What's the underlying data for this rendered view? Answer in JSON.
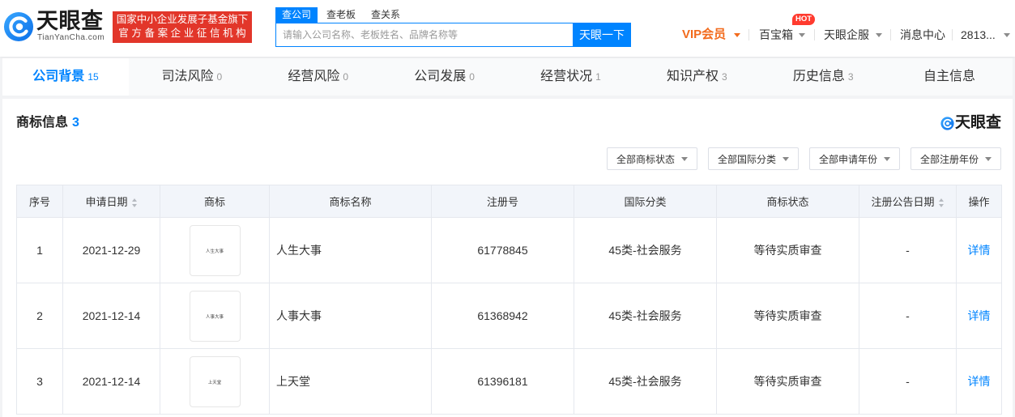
{
  "header": {
    "logo": {
      "name": "天眼查",
      "domain": "TianYanCha.com"
    },
    "badge": {
      "line1": "国家中小企业发展子基金旗下",
      "line2": "官方备案企业征信机构"
    },
    "search_tabs": [
      {
        "label": "查公司",
        "active": true
      },
      {
        "label": "查老板"
      },
      {
        "label": "查关系"
      }
    ],
    "search": {
      "placeholder": "请输入公司名称、老板姓名、品牌名称等",
      "value": "",
      "button_label": "天眼一下"
    },
    "nav": {
      "vip": "VIP会员",
      "treasure": "百宝箱",
      "hot_badge": "HOT",
      "services": "天眼企服",
      "messages": "消息中心",
      "user": "2813..."
    }
  },
  "tabs": [
    {
      "label": "公司背景",
      "count": "15",
      "active": true
    },
    {
      "label": "司法风险",
      "count": "0"
    },
    {
      "label": "经营风险",
      "count": "0"
    },
    {
      "label": "公司发展",
      "count": "0"
    },
    {
      "label": "经营状况",
      "count": "1"
    },
    {
      "label": "知识产权",
      "count": "3"
    },
    {
      "label": "历史信息",
      "count": "3"
    },
    {
      "label": "自主信息"
    }
  ],
  "section": {
    "title": "商标信息",
    "count": "3",
    "brand": "天眼查",
    "filters": [
      "全部商标状态",
      "全部国际分类",
      "全部申请年份",
      "全部注册年份"
    ],
    "table": {
      "columns": [
        "序号",
        "申请日期",
        "商标",
        "商标名称",
        "注册号",
        "国际分类",
        "商标状态",
        "注册公告日期",
        "操作"
      ],
      "rows": [
        {
          "index": "1",
          "apply_date": "2021-12-29",
          "mark_text": "人生大事",
          "name": "人生大事",
          "reg_no": "61778845",
          "intl_class": "45类-社会服务",
          "status": "等待实质审查",
          "announce_date": "-",
          "action": "详情"
        },
        {
          "index": "2",
          "apply_date": "2021-12-14",
          "mark_text": "人事大事",
          "name": "人事大事",
          "reg_no": "61368942",
          "intl_class": "45类-社会服务",
          "status": "等待实质审查",
          "announce_date": "-",
          "action": "详情"
        },
        {
          "index": "3",
          "apply_date": "2021-12-14",
          "mark_text": "上天堂",
          "name": "上天堂",
          "reg_no": "61396181",
          "intl_class": "45类-社会服务",
          "status": "等待实质审查",
          "announce_date": "-",
          "action": "详情"
        }
      ]
    }
  },
  "colors": {
    "primary": "#0084ff",
    "badge": "#e2362a",
    "vip": "#f26b1d",
    "hot": "#ff3b2f"
  }
}
